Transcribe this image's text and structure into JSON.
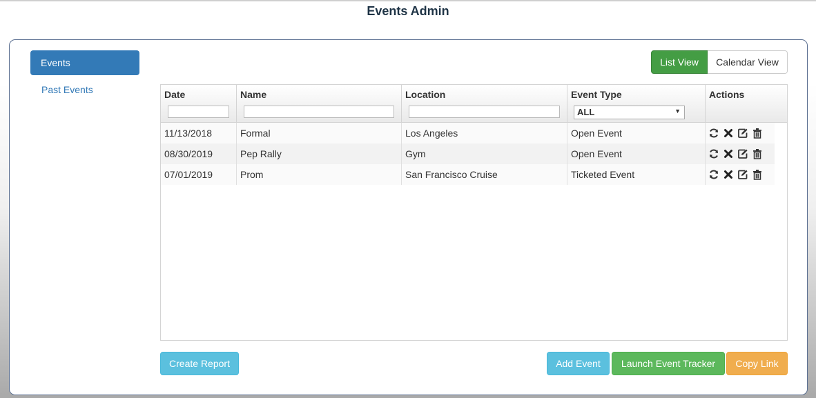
{
  "page": {
    "title": "Events Admin"
  },
  "sidebar": {
    "items": [
      {
        "label": "Events",
        "active": true
      },
      {
        "label": "Past Events",
        "active": false
      }
    ]
  },
  "view_toggle": {
    "list_label": "List View",
    "calendar_label": "Calendar View",
    "selected": "List View"
  },
  "table": {
    "columns": [
      "Date",
      "Name",
      "Location",
      "Event Type",
      "Actions"
    ],
    "filters": {
      "date": "",
      "name": "",
      "location": "",
      "event_type": "ALL"
    },
    "rows": [
      {
        "date": "11/13/2018",
        "name": "Formal",
        "location": "Los Angeles",
        "event_type": "Open Event"
      },
      {
        "date": "08/30/2019",
        "name": "Pep Rally",
        "location": "Gym",
        "event_type": "Open Event"
      },
      {
        "date": "07/01/2019",
        "name": "Prom",
        "location": "San Francisco Cruise",
        "event_type": "Ticketed Event"
      }
    ],
    "row_action_icons": [
      "refresh-icon",
      "close-icon",
      "edit-icon",
      "trash-icon"
    ]
  },
  "footer_buttons": {
    "create_report": "Create Report",
    "add_event": "Add Event",
    "launch_tracker": "Launch Event Tracker",
    "copy_link": "Copy Link"
  },
  "colors": {
    "primary": "#337ab7",
    "success": "#5cb85c",
    "info": "#5bc0de",
    "warning": "#f0ad4e",
    "title": "#1f3446"
  }
}
